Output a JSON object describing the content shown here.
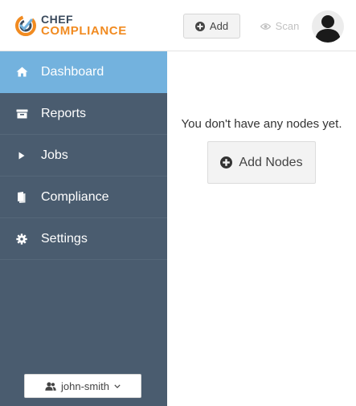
{
  "brand": {
    "line1": "CHEF",
    "line2": "COMPLIANCE",
    "accent_color": "#f18b21",
    "text_color": "#3a4a5c"
  },
  "header": {
    "add_label": "Add",
    "add_icon": "plus-circle-icon",
    "scan_label": "Scan",
    "scan_icon": "eye-icon",
    "avatar_icon": "user-silhouette-icon"
  },
  "sidebar": {
    "bg_color": "#4a5c6f",
    "active_color": "#73b2de",
    "items": [
      {
        "label": "Dashboard",
        "icon": "home-icon",
        "active": true
      },
      {
        "label": "Reports",
        "icon": "inbox-icon",
        "active": false
      },
      {
        "label": "Jobs",
        "icon": "play-icon",
        "active": false
      },
      {
        "label": "Compliance",
        "icon": "book-icon",
        "active": false
      },
      {
        "label": "Settings",
        "icon": "gear-icon",
        "active": false
      }
    ],
    "user": {
      "name": "john-smith",
      "icon": "users-icon",
      "caret_icon": "chevron-down-icon"
    }
  },
  "main": {
    "empty_message": "You don't have any nodes yet.",
    "add_nodes_label": "Add Nodes",
    "add_nodes_icon": "plus-circle-icon"
  }
}
